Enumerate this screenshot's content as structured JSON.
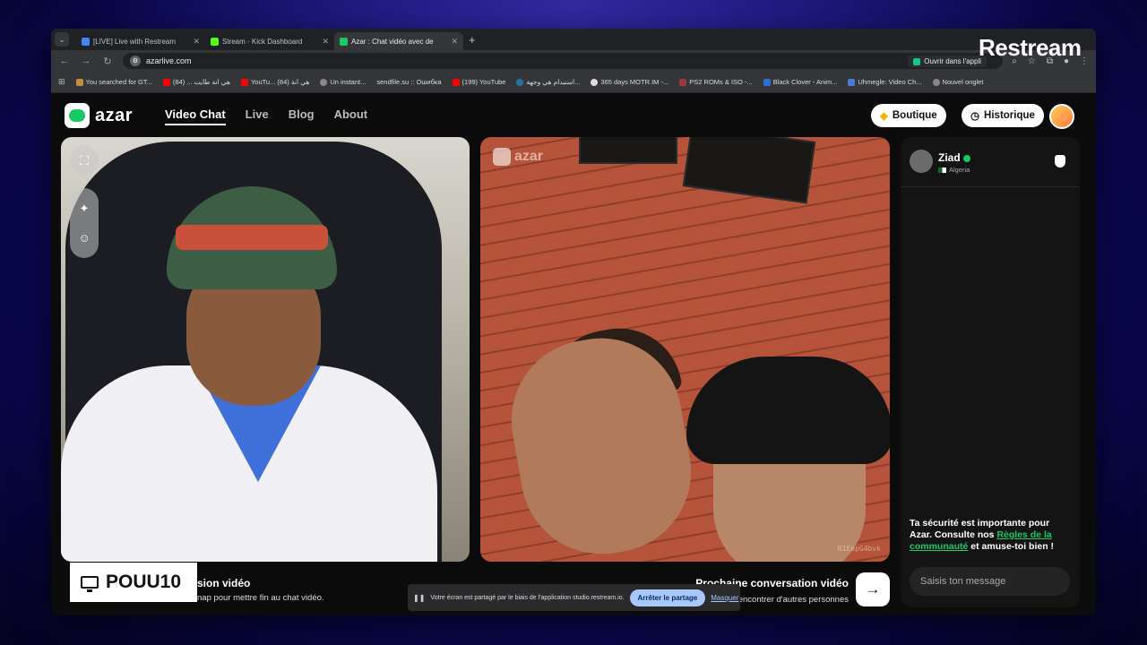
{
  "overlay": {
    "brand": "Restream",
    "streamer": "POUU10"
  },
  "browser": {
    "tabs": [
      {
        "title": "[LIVE] Live with Restream",
        "color": "#4285f4"
      },
      {
        "title": "Stream - Kick Dashboard",
        "color": "#53fc18"
      },
      {
        "title": "Azar : Chat vidéo avec de",
        "color": "#17c964"
      }
    ],
    "url": "azarlive.com",
    "open_in_app": "Ouvrir dans l'appli",
    "bookmarks": [
      "You searched for GT...",
      "هي انة طايت ... (84)",
      "YouTu... هي انة (84)",
      "Un instant...",
      "sendfile.su :: Ошибка",
      "(199) YouTube",
      "استيدام هي وجهة...",
      "365 days MOTR.IM -...",
      "PS2 ROMs & ISO -...",
      "Black Clover - Anim...",
      "Uhmegle: Video Ch...",
      "Nouvel onglet"
    ]
  },
  "azar": {
    "logo": "azar",
    "menu": [
      "Video Chat",
      "Live",
      "Blog",
      "About"
    ],
    "boutique": "Boutique",
    "historique": "Historique",
    "watermark": "azar",
    "video_id": "R1EepG4bvk",
    "left_caption_title": "sion vidéo",
    "left_caption_sub": "nap pour mettre fin au chat vidéo.",
    "right_caption_title": "Prochaine conversation vidéo",
    "right_caption_sub": "encontrer d'autres personnes",
    "chat": {
      "peer_name": "Ziad",
      "peer_country": "Algeria",
      "safety_1": "Ta sécurité est importante pour Azar. Consulte nos ",
      "safety_link": "Règles de la communauté",
      "safety_2": " et amuse-toi bien !",
      "placeholder": "Saisis ton message"
    }
  },
  "screen_share": {
    "message": "Votre écran est partagé par le biais de l'application studio.restream.io.",
    "stop": "Arrêter le partage",
    "hide": "Masquer"
  }
}
